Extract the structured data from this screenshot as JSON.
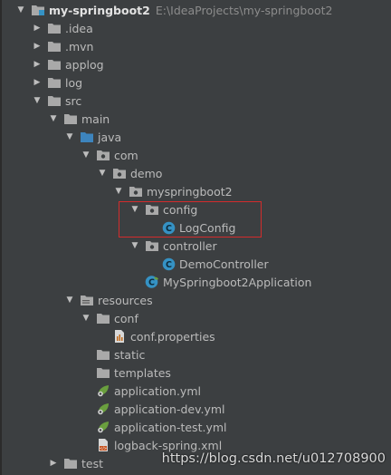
{
  "project": {
    "name": "my-springboot2",
    "path": "E:\\IdeaProjects\\my-springboot2"
  },
  "tree": [
    {
      "label": "my-springboot2",
      "depth": 0,
      "expanded": true,
      "icon": "module-folder-icon",
      "root": true
    },
    {
      "label": ".idea",
      "depth": 1,
      "expanded": false,
      "icon": "folder-icon"
    },
    {
      "label": ".mvn",
      "depth": 1,
      "expanded": false,
      "icon": "folder-icon"
    },
    {
      "label": "applog",
      "depth": 1,
      "expanded": false,
      "icon": "folder-icon"
    },
    {
      "label": "log",
      "depth": 1,
      "expanded": false,
      "icon": "folder-icon"
    },
    {
      "label": "src",
      "depth": 1,
      "expanded": true,
      "icon": "folder-icon"
    },
    {
      "label": "main",
      "depth": 2,
      "expanded": true,
      "icon": "folder-icon"
    },
    {
      "label": "java",
      "depth": 3,
      "expanded": true,
      "icon": "source-folder-icon"
    },
    {
      "label": "com",
      "depth": 4,
      "expanded": true,
      "icon": "package-icon"
    },
    {
      "label": "demo",
      "depth": 5,
      "expanded": true,
      "icon": "package-icon"
    },
    {
      "label": "myspringboot2",
      "depth": 6,
      "expanded": true,
      "icon": "package-icon"
    },
    {
      "label": "config",
      "depth": 7,
      "expanded": true,
      "icon": "package-icon"
    },
    {
      "label": "LogConfig",
      "depth": 8,
      "icon": "class-icon"
    },
    {
      "label": "controller",
      "depth": 7,
      "expanded": true,
      "icon": "package-icon"
    },
    {
      "label": "DemoController",
      "depth": 8,
      "icon": "class-icon"
    },
    {
      "label": "MySpringboot2Application",
      "depth": 7,
      "icon": "spring-class-icon"
    },
    {
      "label": "resources",
      "depth": 3,
      "expanded": true,
      "icon": "resources-folder-icon"
    },
    {
      "label": "conf",
      "depth": 4,
      "expanded": true,
      "icon": "folder-icon"
    },
    {
      "label": "conf.properties",
      "depth": 5,
      "icon": "properties-file-icon"
    },
    {
      "label": "static",
      "depth": 4,
      "icon": "folder-icon"
    },
    {
      "label": "templates",
      "depth": 4,
      "icon": "folder-icon"
    },
    {
      "label": "application.yml",
      "depth": 4,
      "icon": "spring-yml-icon"
    },
    {
      "label": "application-dev.yml",
      "depth": 4,
      "icon": "spring-yml-icon"
    },
    {
      "label": "application-test.yml",
      "depth": 4,
      "icon": "spring-yml-icon"
    },
    {
      "label": "logback-spring.xml",
      "depth": 4,
      "icon": "xml-file-icon"
    },
    {
      "label": "test",
      "depth": 2,
      "expanded": false,
      "icon": "folder-icon"
    }
  ],
  "watermark": "https://blog.csdn.net/u012708900",
  "colors": {
    "background": "#3c3f41",
    "text": "#bbbbbb",
    "folder": "#b0b0b0",
    "source_folder": "#3d84bd",
    "class": "#3592c4",
    "spring": "#6a9f3e",
    "highlight_border": "#d32c2c"
  }
}
